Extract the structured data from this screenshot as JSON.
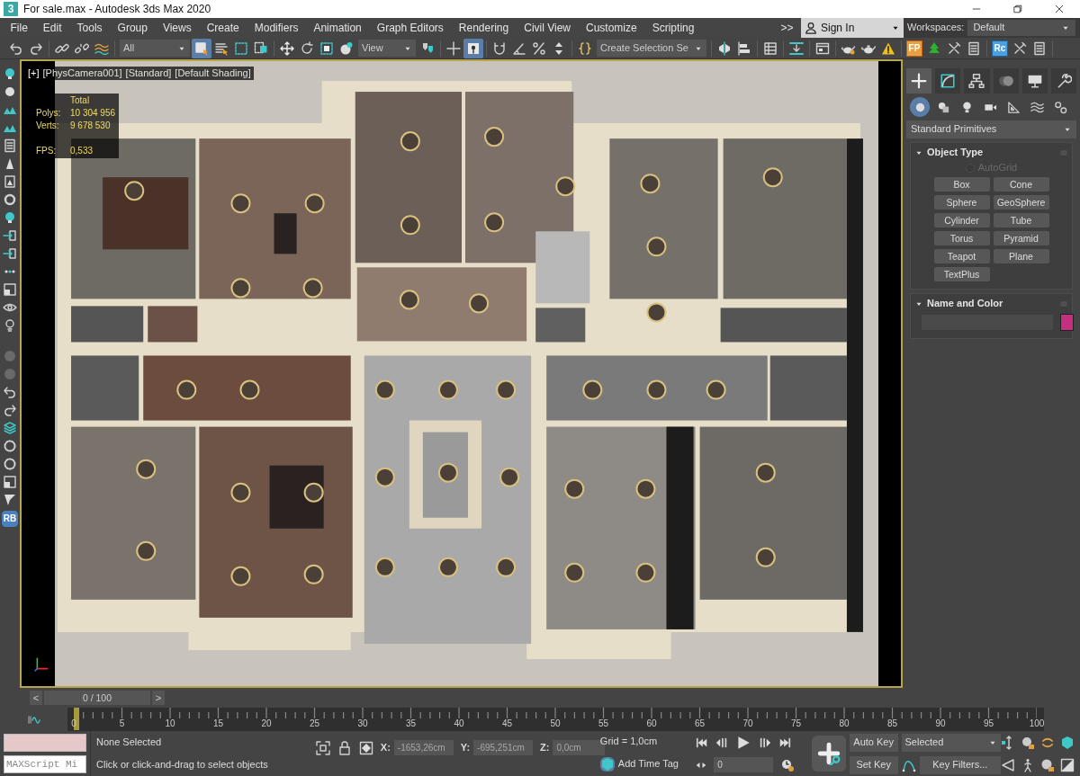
{
  "window": {
    "icon_label": "3",
    "title": "For sale.max - Autodesk 3ds Max 2020"
  },
  "menu": {
    "items": [
      "File",
      "Edit",
      "Tools",
      "Group",
      "Views",
      "Create",
      "Modifiers",
      "Animation",
      "Graph Editors",
      "Rendering",
      "Civil View",
      "Customize",
      "Scripting"
    ],
    "overflow": ">>"
  },
  "sign_in": {
    "label": "Sign In"
  },
  "workspaces": {
    "label": "Workspaces:",
    "value": "Default"
  },
  "toolbar": [
    [
      {
        "kind": "button",
        "selected": false
      },
      {
        "kind": "button",
        "selected": false
      }
    ],
    [
      {
        "kind": "button",
        "selected": false
      },
      {
        "kind": "button",
        "selected": false
      },
      {
        "kind": "button",
        "selected": false
      }
    ],
    [
      {
        "kind": "dropdown",
        "value": "All"
      },
      {
        "kind": "button",
        "selected": true
      },
      {
        "kind": "button",
        "selected": false
      },
      {
        "kind": "button",
        "selected": false
      },
      {
        "kind": "button",
        "selected": false
      }
    ],
    [
      {
        "kind": "button",
        "selected": false
      },
      {
        "kind": "button",
        "selected": false
      },
      {
        "kind": "button",
        "selected": false
      },
      {
        "kind": "button",
        "selected": false
      },
      {
        "kind": "dropdown",
        "value": "View"
      },
      {
        "kind": "button",
        "selected": false
      }
    ],
    [
      {
        "kind": "button",
        "selected": false
      },
      {
        "kind": "button",
        "selected": true
      }
    ],
    [
      {
        "kind": "button",
        "selected": false
      },
      {
        "kind": "button",
        "selected": false
      },
      {
        "kind": "button",
        "selected": false
      },
      {
        "kind": "button",
        "selected": false
      }
    ],
    [
      {
        "kind": "button",
        "selected": false
      },
      {
        "kind": "dropdown",
        "value": "Create Selection Se"
      }
    ],
    [
      {
        "kind": "button",
        "selected": false
      },
      {
        "kind": "button",
        "selected": false
      }
    ],
    [
      {
        "kind": "button",
        "selected": false
      }
    ],
    [
      {
        "kind": "button",
        "selected": false
      }
    ],
    [
      {
        "kind": "button",
        "selected": false
      }
    ],
    [
      {
        "kind": "button",
        "selected": false
      },
      {
        "kind": "button",
        "selected": false
      },
      {
        "kind": "button",
        "selected": false
      }
    ],
    [
      {
        "kind": "badge",
        "label": "FP"
      },
      {
        "kind": "button",
        "selected": false
      },
      {
        "kind": "button",
        "selected": false
      },
      {
        "kind": "button",
        "selected": false
      }
    ],
    [
      {
        "kind": "badge",
        "label": "Rc"
      },
      {
        "kind": "button",
        "selected": false
      },
      {
        "kind": "button",
        "selected": false
      }
    ]
  ],
  "left_toolbar": {
    "badge": "RB"
  },
  "viewport": {
    "active": true,
    "labels": [
      "[+]",
      "[PhysCamera001]",
      "[Standard]",
      "[Default Shading]"
    ],
    "stats": {
      "header": "Total",
      "rows": [
        {
          "label": "Polys:",
          "value": "10 304 956"
        },
        {
          "label": "Verts:",
          "value": "9 678 530"
        },
        {
          "label": "FPS:",
          "value": "0,533"
        }
      ]
    }
  },
  "command_panel": {
    "tabs": [
      {
        "selected": true
      },
      {
        "selected": false
      },
      {
        "selected": false
      },
      {
        "selected": false
      },
      {
        "selected": false
      },
      {
        "selected": false
      }
    ],
    "categories": [
      {
        "selected": true
      },
      {
        "selected": false
      },
      {
        "selected": false
      },
      {
        "selected": false
      },
      {
        "selected": false
      },
      {
        "selected": false
      },
      {
        "selected": false
      }
    ],
    "dropdown": "Standard Primitives",
    "object_type": {
      "title": "Object Type",
      "expanded": true,
      "autogrid": {
        "label": "AutoGrid",
        "checked": false,
        "disabled": true
      },
      "buttons": [
        "Box",
        "Cone",
        "Sphere",
        "GeoSphere",
        "Cylinder",
        "Tube",
        "Torus",
        "Pyramid",
        "Teapot",
        "Plane",
        "TextPlus"
      ]
    },
    "name_and_color": {
      "title": "Name and Color",
      "expanded": true,
      "color": "#c2307e"
    }
  },
  "timeline": {
    "slider": {
      "prev": "<",
      "label": "0 / 100",
      "next": ">",
      "level": 0
    },
    "ticks": [
      "0",
      "5",
      "10",
      "15",
      "20",
      "25",
      "30",
      "35",
      "40",
      "45",
      "50",
      "55",
      "60",
      "65",
      "70",
      "75",
      "80",
      "85",
      "90",
      "95",
      "100"
    ]
  },
  "status": {
    "listener": {
      "value": "MAXScript Mi"
    },
    "selection": "None Selected",
    "prompt": "Click or click-and-drag to select objects",
    "coords": [
      {
        "label": "X:",
        "value": "-1653,26cm"
      },
      {
        "label": "Y:",
        "value": "-695,251cm"
      },
      {
        "label": "Z:",
        "value": "0,0cm"
      }
    ],
    "grid": "Grid = 1,0cm",
    "time_tag": "Add Time Tag",
    "frame": "0",
    "auto_key": "Auto Key",
    "set_key": "Set Key",
    "key_mode": "Selected",
    "key_filters": "Key Filters..."
  }
}
